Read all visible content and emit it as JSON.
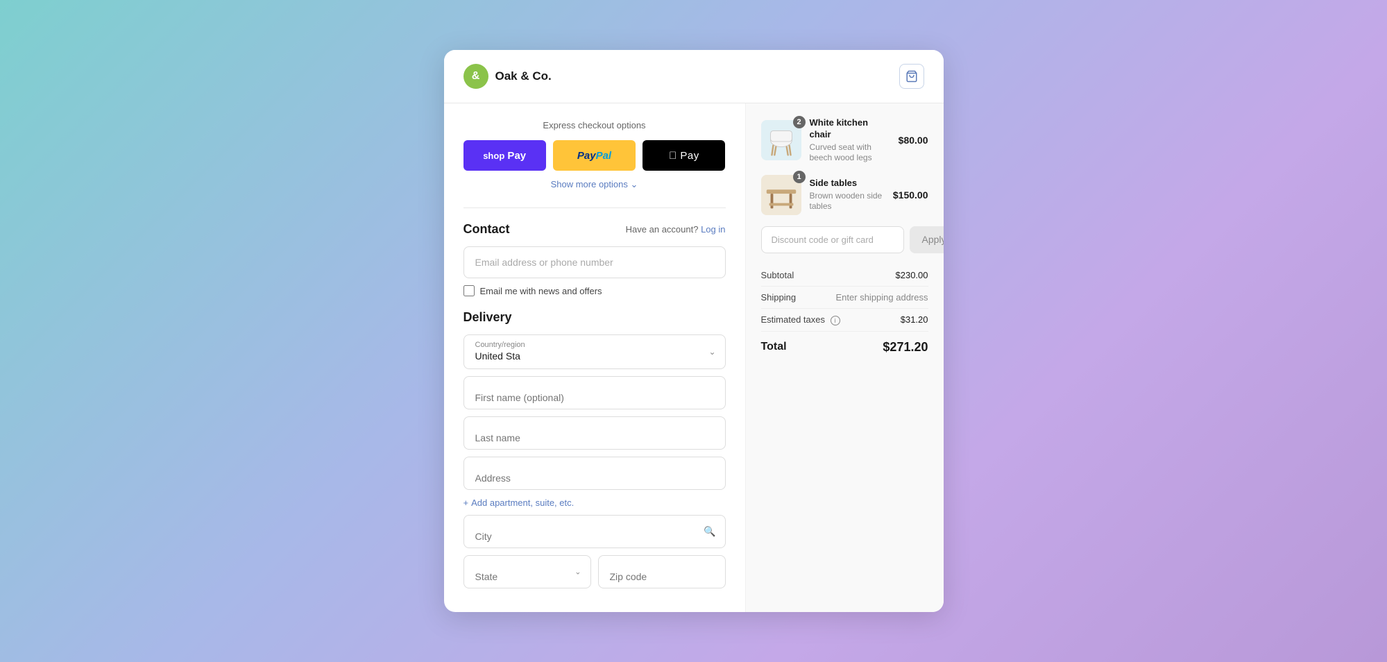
{
  "app": {
    "logo_letter": "&",
    "logo_name": "Oak & Co."
  },
  "express": {
    "title": "Express checkout options",
    "shop_pay_label": "shop Pay",
    "paypal_label": "PayPal",
    "apple_pay_label": " Pay",
    "show_more_label": "Show more options"
  },
  "contact": {
    "title": "Contact",
    "have_account": "Have an account?",
    "login_label": "Log in",
    "email_placeholder": "Email address or phone number",
    "newsletter_label": "Email me with news and offers"
  },
  "delivery": {
    "title": "Delivery",
    "country_label": "Country/region",
    "country_value": "United Sta",
    "first_name_placeholder": "First name (optional)",
    "last_name_placeholder": "Last name",
    "address_placeholder": "Address",
    "add_apt_label": "Add apartment, suite, etc.",
    "city_placeholder": "City",
    "state_placeholder": "State",
    "zip_placeholder": "Zip code"
  },
  "order": {
    "items": [
      {
        "name": "White kitchen chair",
        "description": "Curved seat with beech wood legs",
        "price": "$80.00",
        "quantity": 2
      },
      {
        "name": "Side tables",
        "description": "Brown wooden side tables",
        "price": "$150.00",
        "quantity": 1
      }
    ],
    "discount_placeholder": "Discount code or gift card",
    "apply_label": "Apply",
    "subtotal_label": "Subtotal",
    "subtotal_value": "$230.00",
    "shipping_label": "Shipping",
    "shipping_value": "Enter shipping address",
    "taxes_label": "Estimated taxes",
    "taxes_value": "$31.20",
    "total_label": "Total",
    "total_value": "$271.20"
  }
}
